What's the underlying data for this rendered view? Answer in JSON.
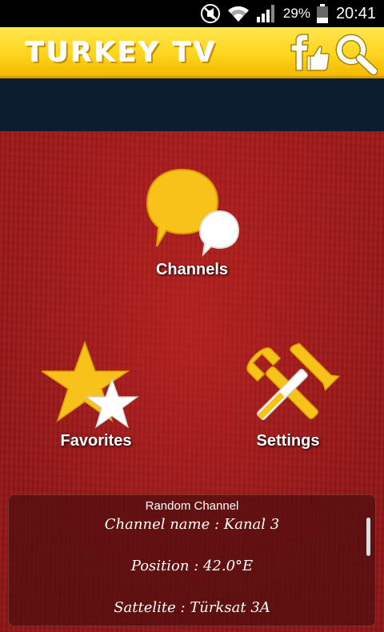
{
  "status_bar": {
    "battery_percent": "29%",
    "time": "20:41",
    "icons": [
      "mute-icon",
      "wifi-icon",
      "signal-icon",
      "battery-icon"
    ]
  },
  "app_bar": {
    "title": "TURKEY TV",
    "actions": [
      "facebook-like-icon",
      "search-icon"
    ]
  },
  "menu": {
    "channels": "Channels",
    "favorites": "Favorites",
    "settings": "Settings"
  },
  "random_channel": {
    "heading": "Random Channel",
    "name_line": "Channel name : Kanal 3",
    "position_line": "Position : 42.0°E",
    "satellite_line": "Sattelite : Türksat 3A"
  },
  "colors": {
    "appbar_yellow": "#ffd51e",
    "carpet_red": "#9a1818",
    "banner_navy": "#0a1e30",
    "icon_yellow": "#f7c21a"
  }
}
